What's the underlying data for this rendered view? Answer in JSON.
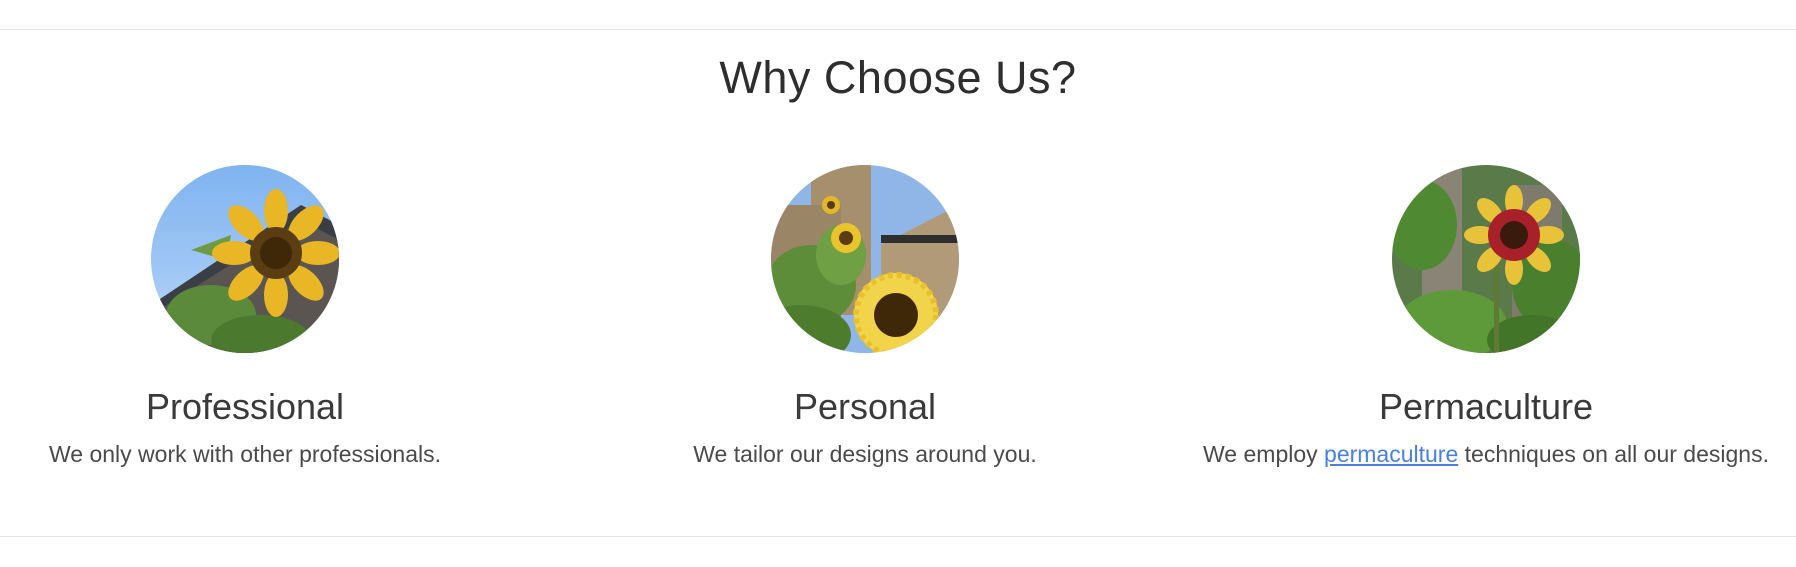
{
  "section": {
    "title": "Why Choose Us?"
  },
  "features": [
    {
      "title": "Professional",
      "description": "We only work with other professionals.",
      "image_icon": "sunflower-sky-photo"
    },
    {
      "title": "Personal",
      "description": "We tailor our designs around you.",
      "image_icon": "sunflower-garden-photo"
    },
    {
      "title": "Permaculture",
      "description_before": "We employ ",
      "description_link": "permaculture",
      "description_after": " techniques on all our designs.",
      "image_icon": "red-sunflower-photo"
    }
  ],
  "colors": {
    "link": "#4a7fe0",
    "divider": "#e3e3e3",
    "heading": "#2e2e2e"
  }
}
